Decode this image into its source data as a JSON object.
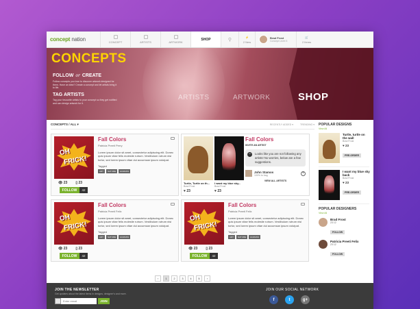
{
  "brand": {
    "name_a": "concept",
    "name_b": "nation"
  },
  "nav": {
    "items": [
      {
        "label": "CONCEPT"
      },
      {
        "label": "ARTISTS"
      },
      {
        "label": "ARTWORK"
      },
      {
        "label": "SHOP"
      }
    ],
    "news_label": "2 New",
    "user_name": "Brad Frost",
    "user_sub": "Concept Level 3",
    "cart_label": "2 Items"
  },
  "hero": {
    "title": "CONCEPTS",
    "follow_a": "FOLLOW",
    "follow_or": "or",
    "follow_b": "CREATE",
    "follow_desc": "Follow concepts you love to discover artwork designed for them. Have an idea? Create a concept and let artists bring it to life.",
    "tag_title": "TAG ARTISTS",
    "tag_desc": "Tag your favourite artists to your concept so they get notified and can design artwork for it.",
    "tabs": {
      "artists": "ARTISTS",
      "artwork": "ARTWORK",
      "shop": "SHOP"
    }
  },
  "filters": {
    "left": "CONCEPTS / ALL",
    "recent": "RECENTLY ADDED",
    "trending": "TRENDING"
  },
  "card": {
    "title": "Fall Colors",
    "artist": "Patricia Preeti Felix",
    "artist_alt": "Patricia Preeti Perry",
    "desc": "Lorem ipsum dolor sit amet, consectetur adipiscing elit. Donec quis ipsum vitae felis molestie rutrum. Vestibulum rutrum nisi tortor, sed lorem ipsum vitae dui accumsan ipsum volutpat.",
    "tagged": "Tagged",
    "tags": [
      "ART",
      "NATURE",
      "HUMANS"
    ],
    "views": "23",
    "comments": "23",
    "follow": "FOLLOW",
    "followers": "42",
    "art_a": "OH",
    "art_b": "FRICK!"
  },
  "wide": {
    "title": "Fall Colors",
    "invite": "INVITE AN ARTIST",
    "bubble": "Looks like you are not following any artists! No worries, below are a few suggestions.",
    "john_name": "John Stamos",
    "john_sub": "100% to bag",
    "view_all": "VIEW ALL ARTISTS",
    "art1_title": "Turtle, Turtle on th...",
    "art1_sub": "Brad Frost",
    "art2_title": "I want my blue sky...",
    "art2_sub": "Brad Frost",
    "likes": "23"
  },
  "pager": {
    "prev": "‹",
    "pages": [
      "1",
      "2",
      "3",
      "4",
      "5"
    ],
    "next": "›"
  },
  "sidebar": {
    "popular_designs": "POPULAR DESIGNS",
    "view_all": "View All",
    "designs": [
      {
        "title": "Turtle, turtle on the wall",
        "artist": "Brad Frost",
        "likes": "23",
        "btn": "PRE-ORDER"
      },
      {
        "title": "I want my blue sky back",
        "artist": "Brad Frost",
        "likes": "23",
        "btn": "PRE-ORDER"
      }
    ],
    "popular_designers": "POPULAR DESIGNERS",
    "designers": [
      {
        "name": "Brad Frost",
        "stats": "23   12",
        "btn": "FOLLOW"
      },
      {
        "name": "Patricia Preeti Felix",
        "stats": "23   12",
        "btn": "FOLLOW"
      }
    ]
  },
  "footer": {
    "newsletter_title": "JOIN THE NEWSLETTER",
    "newsletter_sub": "Get updates about the latest items in designs, designer's and more.",
    "email_placeholder": "Enter email",
    "join": "JOIN",
    "social_title": "JOIN OUR SOCIAL NETWORK",
    "socials": [
      "f",
      "t",
      "g+"
    ]
  },
  "colors": {
    "accent": "#7bb32e",
    "title": "#c23a63",
    "hero_title": "#ffd400"
  }
}
